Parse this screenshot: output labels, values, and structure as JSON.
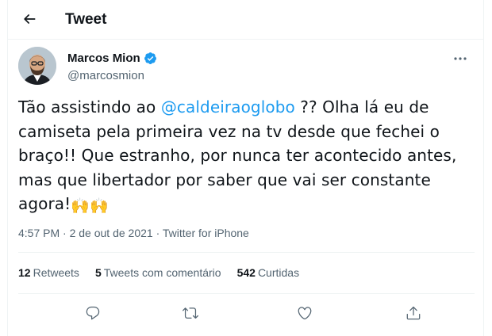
{
  "header": {
    "title": "Tweet"
  },
  "author": {
    "display_name": "Marcos Mion",
    "handle": "@marcosmion"
  },
  "tweet": {
    "text_before_mention": "Tão assistindo ao ",
    "mention": "@caldeiraoglobo",
    "text_after_mention": " ?? Olha lá eu de camiseta pela primeira vez na tv desde que fechei o braço!! Que estranho, por nunca ter acontecido antes, mas que libertador por saber que vai ser constante agora!",
    "emoji": "🙌🙌",
    "time": "4:57 PM",
    "separator": "·",
    "date": "2 de out de 2021",
    "source": "Twitter for iPhone"
  },
  "stats": {
    "retweets_count": "12",
    "retweets_label": "Retweets",
    "quotes_count": "5",
    "quotes_label": "Tweets com comentário",
    "likes_count": "542",
    "likes_label": "Curtidas"
  },
  "colors": {
    "accent": "#1d9bf0",
    "secondary_text": "#536471",
    "primary_text": "#0f1419",
    "divider": "#eff3f4"
  },
  "icons": [
    "back-arrow-icon",
    "verified-badge-icon",
    "more-options-icon",
    "reply-icon",
    "retweet-icon",
    "like-icon",
    "share-icon"
  ]
}
